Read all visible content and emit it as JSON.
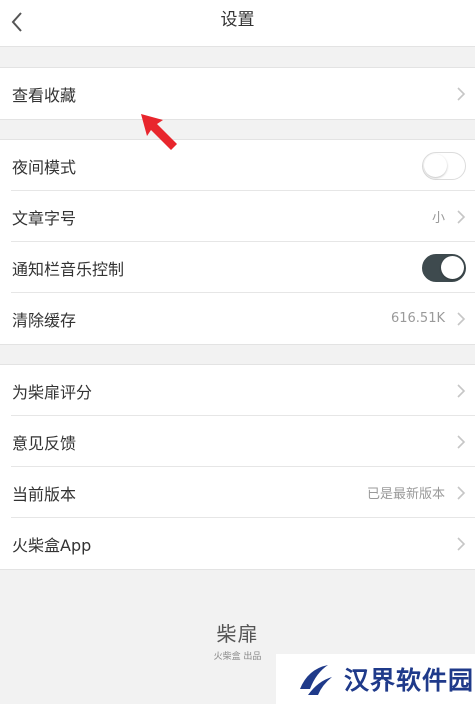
{
  "header": {
    "title": "设置",
    "back_icon": "chevron-left-icon"
  },
  "groups": [
    {
      "rows": [
        {
          "label": "查看收藏",
          "control": "chevron"
        }
      ]
    },
    {
      "rows": [
        {
          "label": "夜间模式",
          "control": "toggle",
          "on": false
        },
        {
          "label": "文章字号",
          "control": "chevron",
          "value": "小"
        },
        {
          "label": "通知栏音乐控制",
          "control": "toggle",
          "on": true
        },
        {
          "label": "清除缓存",
          "control": "chevron",
          "value": "616.51K"
        }
      ]
    },
    {
      "rows": [
        {
          "label": "为柴扉评分",
          "control": "chevron"
        },
        {
          "label": "意见反馈",
          "control": "chevron"
        },
        {
          "label": "当前版本",
          "control": "chevron",
          "value": "已是最新版本"
        },
        {
          "label": "火柴盒App",
          "control": "chevron"
        }
      ]
    }
  ],
  "footer": {
    "brand_name": "柴扉",
    "brand_sub": "火柴盒 出品"
  },
  "watermark": {
    "text": "汉界软件园"
  },
  "colors": {
    "background": "#f2f2f2",
    "toggle_on": "#3e4a4e",
    "cursor_arrow": "#e8262d",
    "watermark_text": "#1f3a8a"
  }
}
